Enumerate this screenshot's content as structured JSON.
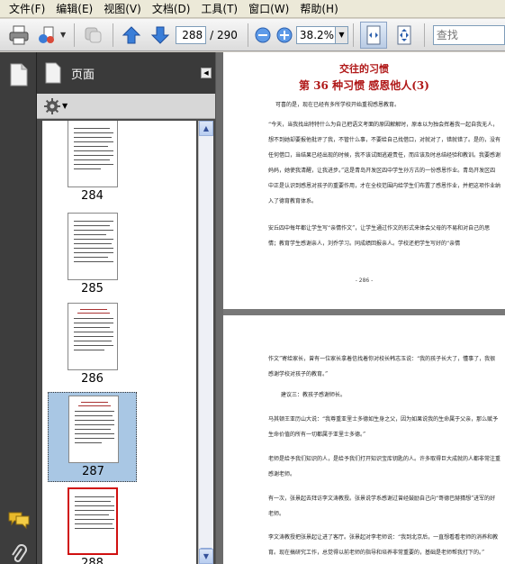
{
  "menu": [
    "文件(F)",
    "编辑(E)",
    "视图(V)",
    "文档(D)",
    "工具(T)",
    "窗口(W)",
    "帮助(H)"
  ],
  "toolbar": {
    "current_page": "288",
    "total_pages": "/ 290",
    "zoom": "38.2%",
    "search_placeholder": "查找",
    "icons": [
      "print-icon",
      "share-icon",
      "comment-icon",
      "arrow-up-icon",
      "arrow-down-icon",
      "zoom-out-icon",
      "zoom-in-icon",
      "fit-width-icon",
      "fit-page-icon"
    ]
  },
  "panel": {
    "title": "页面",
    "thumbnails": [
      {
        "label": "284",
        "selected": false
      },
      {
        "label": "285",
        "selected": false
      },
      {
        "label": "286",
        "selected": false
      },
      {
        "label": "287",
        "selected": true
      },
      {
        "label": "288",
        "selected": false,
        "current": true
      }
    ]
  },
  "document": {
    "page1": {
      "title1": "交往的习惯",
      "title2": "第 36 种习惯 感恩他人(3)",
      "paragraphs": [
        "可喜的是，现在已经有多所学校开始重视感恩教育。",
        "“今天，当我找出特特什么为自己把语文考面的原因解解时，原本以为独会挥着我一起自我无人，想不到她却要报他批评了我，不管什么事，不要给自己找借口，对就对了，错就错了。是的，没有任何借口，当结果已经出现的时候，我不该试图逃避责任，而应该及时总结经验和教训。我要感谢妈妈，她使我清醒，让我进步。”这是青岛开发区四中学生孙方古的一份感恩作业。青岛开发区四中正是认识到感恩对孩子的重要作用，才在全校范围内给学生们布置了感恩作业，并把这项作业纳入了德育教育体系。",
        "安丘四中每年都让学生写“亲情作文”，让学生通过作文的形式来体会父母的不易和对自己的思情；教育学生感谢亲人，刘乔学习。同成绩回报亲人。学校还把学生写好的“亲情"
      ],
      "page_number": "- 286 -"
    },
    "page2": {
      "paragraphs": [
        "作文”寄给家长，曾有一位家长拿着信找着你对校长韩志玉说：“我的孩子长大了，懂事了，我很感谢学校对孩子的教育。”",
        "建议三：教孩子感谢师长。",
        "马其顿王亚历山大说：“我尊重亚里士多德如生身之父，因为如果说我的生命属于父亲，那么赋予生命价值的所有一切都属于亚里士多德。”",
        "老师是给予我们知识的人，是给予我们打开知识宝库钥匙的人。许多取得巨大成就的人都非常注重感谢老师。",
        "有一次，张景起去拜访李文涛教授。张景说学系感谢过曾经鼓励自己向“哥德巴赫猜想”进军的好老师。",
        "李文涛教授把张景起让进了客厅。张景起对李老师说：“我到北京后，一直想看看老师的消养和教育。现在搞研究工作，总觉得以前老师的指导和培养非常重要的，基础是老师帮我打下的。”"
      ]
    }
  }
}
